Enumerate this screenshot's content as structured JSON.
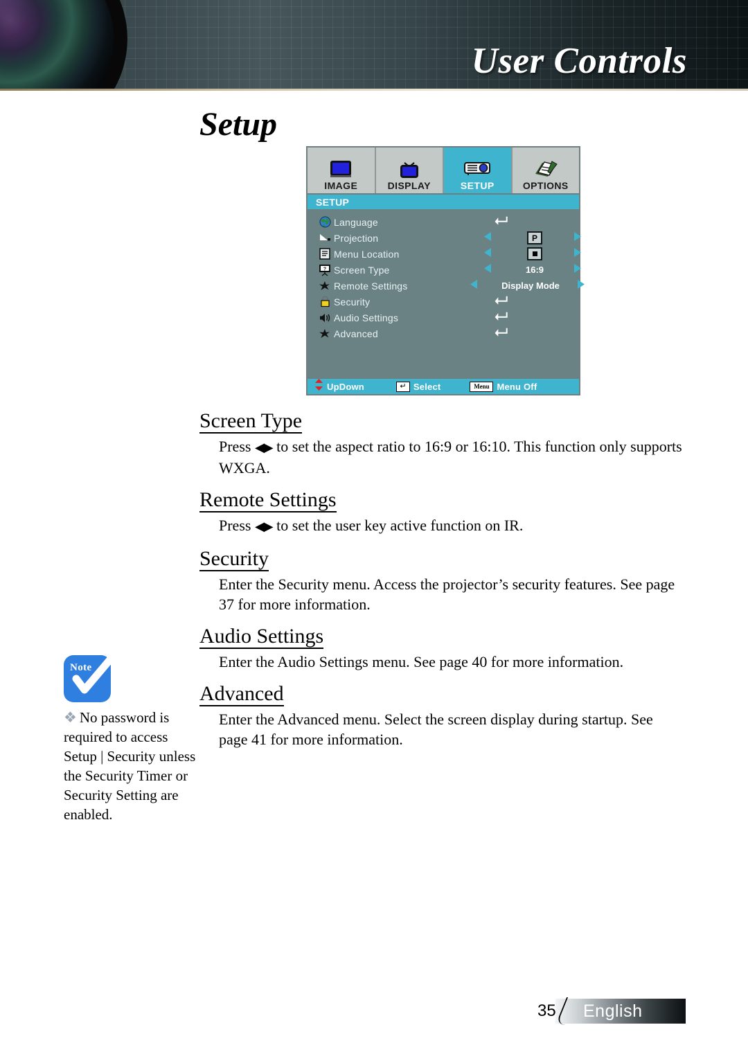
{
  "header": {
    "title": "User Controls",
    "lens_icon": "projector-lens-icon"
  },
  "page_title": "Setup",
  "osd": {
    "tabs": [
      {
        "label": "IMAGE",
        "icon": "monitor-icon",
        "active": false
      },
      {
        "label": "DISPLAY",
        "icon": "television-icon",
        "active": false
      },
      {
        "label": "SETUP",
        "icon": "projector-icon",
        "active": true
      },
      {
        "label": "OPTIONS",
        "icon": "document-pen-icon",
        "active": false
      }
    ],
    "section_title": "SETUP",
    "rows": [
      {
        "label": "Language",
        "icon": "globe-icon",
        "control": "enter",
        "value": ""
      },
      {
        "label": "Projection",
        "icon": "projection-icon",
        "control": "arrows",
        "value": "P"
      },
      {
        "label": "Menu Location",
        "icon": "menu-page-icon",
        "control": "arrows",
        "value": "center-box"
      },
      {
        "label": "Screen Type",
        "icon": "screen-icon",
        "control": "arrows",
        "value": "16:9"
      },
      {
        "label": "Remote Settings",
        "icon": "star-icon",
        "control": "arrows",
        "value": "Display Mode"
      },
      {
        "label": "Security",
        "icon": "padlock-icon",
        "control": "enter",
        "value": ""
      },
      {
        "label": "Audio Settings",
        "icon": "speaker-icon",
        "control": "enter",
        "value": ""
      },
      {
        "label": "Advanced",
        "icon": "star-icon",
        "control": "enter",
        "value": ""
      }
    ],
    "status": [
      {
        "label": "UpDown",
        "icon": "updown-arrows-icon"
      },
      {
        "label": "Select",
        "icon": "enter-key-icon"
      },
      {
        "label": "Menu Off",
        "icon": "menu-key-icon",
        "key_text": "Menu"
      }
    ],
    "colors": {
      "accent": "#3fb4cf",
      "panel": "#6b8285",
      "tab_inactive": "#c3c9c6"
    }
  },
  "sections": [
    {
      "heading": "Screen Type",
      "body_pre": "Press ",
      "arrows": "◀▶",
      "body_post": " to set the aspect ratio to 16:9 or 16:10. This function only supports WXGA."
    },
    {
      "heading": "Remote Settings",
      "body_pre": "Press ",
      "arrows": "◀▶",
      "body_post": " to set the user key active function on IR."
    },
    {
      "heading": "Security",
      "body_pre": "",
      "arrows": "",
      "body_post": "Enter the Security menu. Access the projector’s security features. See page 37 for more information."
    },
    {
      "heading": "Audio Settings",
      "body_pre": "",
      "arrows": "",
      "body_post": "Enter the Audio Settings menu. See page 40 for more information."
    },
    {
      "heading": "Advanced",
      "body_pre": "",
      "arrows": "",
      "body_post": "Enter the Advanced menu. Select the screen display during startup. See page 41 for more information."
    }
  ],
  "note": {
    "icon_label": "Note",
    "bullet": "❖",
    "text": "No password is required to access Setup | Security unless the Security Timer or Security Setting are enabled."
  },
  "footer": {
    "page_number": "35",
    "language": "English"
  }
}
